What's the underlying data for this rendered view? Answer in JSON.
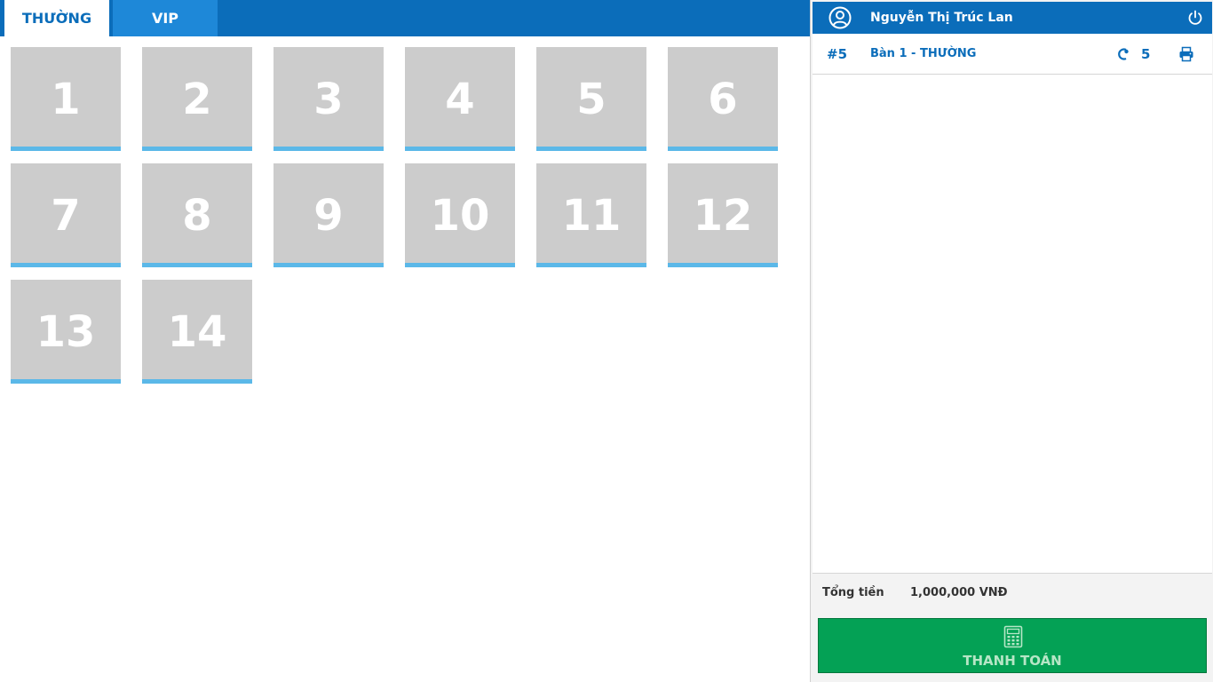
{
  "tabs": [
    {
      "label": "THƯỜNG"
    },
    {
      "label": "VIP"
    }
  ],
  "tables": [
    "1",
    "2",
    "3",
    "4",
    "5",
    "6",
    "7",
    "8",
    "9",
    "10",
    "11",
    "12",
    "13",
    "14"
  ],
  "panel": {
    "user_name": "Nguyễn Thị Trúc Lan",
    "order_number": "#5",
    "table_name": "Bàn 1 - THƯỜNG",
    "guest_count": "5",
    "total_label": "Tổng tiền",
    "total_value": "1,000,000 VNĐ",
    "pay_label": "THANH TOÁN"
  },
  "colors": {
    "primary": "#0b6dba",
    "tile": "#cccccc",
    "tile_accent": "#5bb8e8",
    "pay": "#04a155"
  },
  "icons": [
    "user-icon",
    "power-icon",
    "guest-icon",
    "print-icon",
    "calculator-icon"
  ]
}
